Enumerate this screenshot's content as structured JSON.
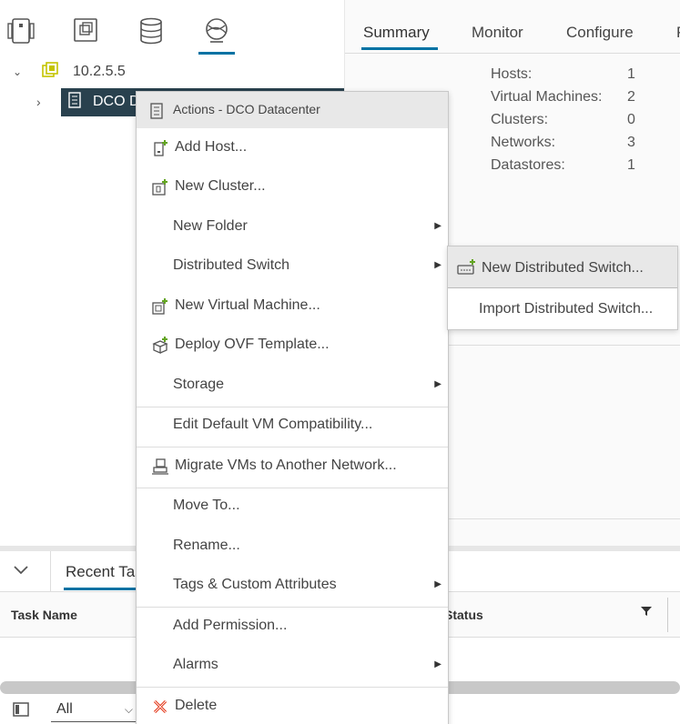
{
  "colors": {
    "accent": "#0072a3",
    "selected_row_bg": "#29414e",
    "add_green": "#62a420",
    "delete_red": "#e12200",
    "vcenter_icon_yellow": "#c4c400"
  },
  "left_nav": {
    "icons": [
      "hosts-clusters-icon",
      "vms-templates-icon",
      "storage-icon",
      "networking-icon"
    ],
    "active_index": 3
  },
  "tree": {
    "vcenter": {
      "label": "10.2.5.5",
      "icon": "vcenter-icon"
    },
    "datacenter": {
      "label": "DCO D",
      "icon": "datacenter-icon"
    }
  },
  "tabs": [
    {
      "label": "Summary",
      "active": true
    },
    {
      "label": "Monitor"
    },
    {
      "label": "Configure"
    },
    {
      "label": "P"
    }
  ],
  "summary": {
    "stats": [
      {
        "label": "Hosts:",
        "value": "1"
      },
      {
        "label": "Virtual Machines:",
        "value": "2"
      },
      {
        "label": "Clusters:",
        "value": "0"
      },
      {
        "label": "Networks:",
        "value": "3"
      },
      {
        "label": "Datastores:",
        "value": "1"
      }
    ]
  },
  "context_menu": {
    "header": "Actions - DCO Datacenter",
    "items": [
      {
        "label": "Add Host...",
        "icon": "add-host-icon"
      },
      {
        "label": "New Cluster...",
        "icon": "new-cluster-icon"
      },
      {
        "label": "New Folder",
        "submenu": true
      },
      {
        "label": "Distributed Switch",
        "submenu": true
      },
      {
        "label": "New Virtual Machine...",
        "icon": "new-vm-icon"
      },
      {
        "label": "Deploy OVF Template...",
        "icon": "deploy-ovf-icon"
      },
      {
        "label": "Storage",
        "submenu": true
      },
      {
        "label": "Edit Default VM Compatibility..."
      },
      {
        "label": "Migrate VMs to Another Network...",
        "icon": "migrate-vms-icon"
      },
      {
        "label": "Move To..."
      },
      {
        "label": "Rename..."
      },
      {
        "label": "Tags & Custom Attributes",
        "submenu": true
      },
      {
        "label": "Add Permission..."
      },
      {
        "label": "Alarms",
        "submenu": true
      },
      {
        "label": "Delete",
        "icon": "delete-icon"
      }
    ]
  },
  "submenu": {
    "items": [
      {
        "label": "New Distributed Switch...",
        "icon": "new-distributed-switch-icon",
        "highlighted": true
      },
      {
        "label": "Import Distributed Switch..."
      }
    ]
  },
  "bottom_panel": {
    "tab_label": "Recent Tasks",
    "columns": [
      "Task Name",
      "Status"
    ],
    "filter_value": "All"
  }
}
